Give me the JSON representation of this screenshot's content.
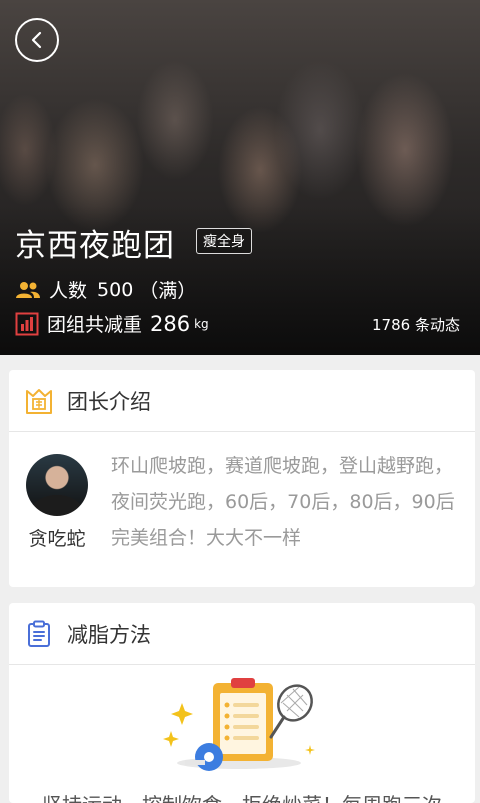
{
  "header": {
    "team_name": "京西夜跑团",
    "tag": "瘦全身",
    "members_label": "人数",
    "members_count": "500",
    "members_status": "（满）",
    "weight_label": "团组共减重",
    "weight_value": "286",
    "weight_unit": "kg",
    "posts_count": "1786",
    "posts_label": "条动态"
  },
  "leader_section": {
    "title": "团长介绍",
    "leader_name": "贪吃蛇",
    "intro": "环山爬坡跑，赛道爬坡跑，登山越野跑，夜间荧光跑，60后，70后，80后，90后完美组合！大大不一样"
  },
  "method_section": {
    "title": "减脂方法",
    "text": "坚持运动，控制饮食，拒绝炒菜！每周跑三次"
  },
  "colors": {
    "accent_yellow": "#f3b233",
    "accent_blue": "#4a6fd8",
    "accent_red": "#e04040"
  }
}
